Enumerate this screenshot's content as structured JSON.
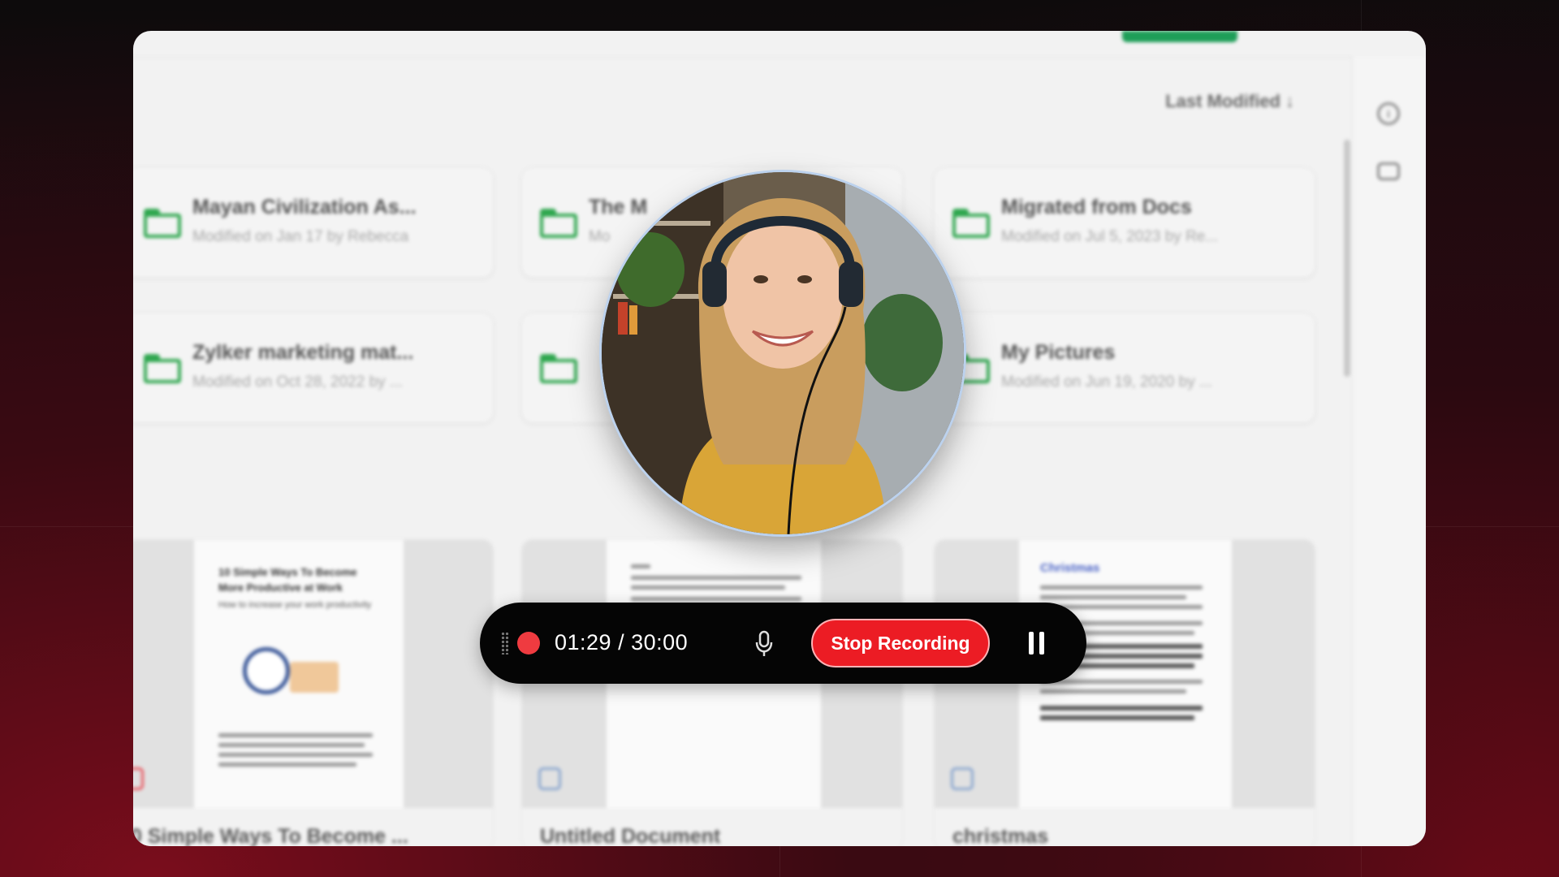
{
  "sort": {
    "label": "Last Modified",
    "arrow": "↓"
  },
  "folders": [
    {
      "name": "Mayan Civilization As...",
      "meta": "Modified on Jan 17 by Rebecca"
    },
    {
      "name": "The M",
      "meta": "Mo"
    },
    {
      "name": "Migrated from Docs",
      "meta": "Modified on Jul 5, 2023 by Re..."
    },
    {
      "name": "Zylker marketing mat...",
      "meta": "Modified on Oct 28, 2022 by ..."
    },
    {
      "name": "",
      "meta": ""
    },
    {
      "name": "My Pictures",
      "meta": "Modified on Jun 19, 2020 by ..."
    }
  ],
  "documents": [
    {
      "name": "0 Simple Ways To Become ...",
      "heading": "10 Simple Ways To Become More Productive at Work",
      "subheading": "How to increase your work productivity"
    },
    {
      "name": "Untitled Document"
    },
    {
      "name": "christmas",
      "heading": "Christmas"
    }
  ],
  "recorder": {
    "elapsed": "01:29",
    "limit": "30:00",
    "timer_text": "01:29 / 30:00",
    "stop_label": "Stop Recording",
    "recording": true
  },
  "colors": {
    "record": "#ef3b40",
    "stop_button": "#ec1c24",
    "folder": "#2fa74f",
    "accent_green": "#1e9e58"
  },
  "icons": {
    "info": "info-icon",
    "chat": "comment-icon",
    "mic": "microphone-icon",
    "pause": "pause-icon",
    "drag": "drag-handle-icon",
    "folder": "folder-icon"
  }
}
